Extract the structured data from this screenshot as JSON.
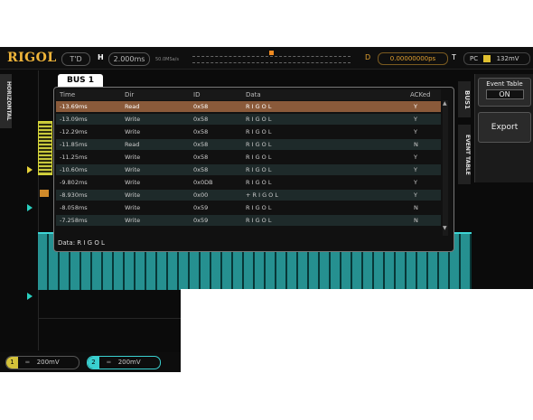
{
  "topbar": {
    "logo": "RIGOL",
    "mode": "T'D",
    "h_label": "H",
    "timebase": "2.000ms",
    "sample": "50.0MSa/s",
    "d_label": "D",
    "trig_delay": "0.00000000ps",
    "t_label": "T",
    "trig_source": "PC",
    "trig_level": "132mV"
  },
  "left_tab": {
    "label": "HORIZONTAL"
  },
  "right_tabs": {
    "bus": "BUS1",
    "event": "EVENT TABLE"
  },
  "right_panel": {
    "title": "Event Table",
    "state": "ON",
    "export": "Export"
  },
  "event_window": {
    "tab": "BUS 1",
    "columns": [
      "Time",
      "Dir",
      "ID",
      "Data",
      "ACKed"
    ],
    "rows": [
      {
        "time": "-13.69ms",
        "dir": "Read",
        "id": "0x58",
        "data": "R I G O L",
        "ack": "Y"
      },
      {
        "time": "-13.09ms",
        "dir": "Write",
        "id": "0x58",
        "data": "R I G O L",
        "ack": "Y"
      },
      {
        "time": "-12.29ms",
        "dir": "Write",
        "id": "0x58",
        "data": "R I G O L",
        "ack": "Y"
      },
      {
        "time": "-11.85ms",
        "dir": "Read",
        "id": "0x58",
        "data": "R I G O L",
        "ack": "N"
      },
      {
        "time": "-11.25ms",
        "dir": "Write",
        "id": "0x58",
        "data": "R I G O L",
        "ack": "Y"
      },
      {
        "time": "-10.60ms",
        "dir": "Write",
        "id": "0x58",
        "data": "R I G O L",
        "ack": "Y"
      },
      {
        "time": "-9.802ms",
        "dir": "Write",
        "id": "0x0DB",
        "data": "R I G O L",
        "ack": "Y"
      },
      {
        "time": "-8.930ms",
        "dir": "Write",
        "id": "0x00",
        "data": "+ R I G O L",
        "ack": "Y"
      },
      {
        "time": "-8.058ms",
        "dir": "Write",
        "id": "0x59",
        "data": "R I G O L",
        "ack": "N"
      },
      {
        "time": "-7.258ms",
        "dir": "Write",
        "id": "0x59",
        "data": "R I G O L",
        "ack": "N"
      }
    ],
    "data_line": "Data: R I G O L"
  },
  "bottom": {
    "ch1_num": "1",
    "ch1_scale": "200mV",
    "ch2_num": "2",
    "ch2_scale": "200mV"
  }
}
